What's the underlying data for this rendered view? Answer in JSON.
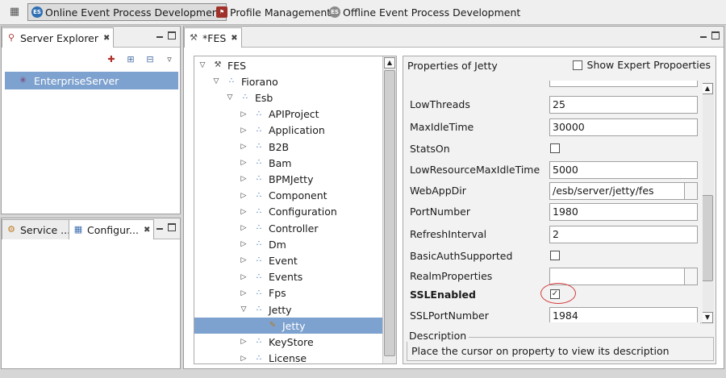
{
  "perspectives": {
    "items": [
      {
        "label": "Online Event Process Development",
        "icon": "es-circle-icon",
        "active": true
      },
      {
        "label": "Profile Management",
        "icon": "profile-icon",
        "active": false
      },
      {
        "label": "Offline Event Process Development",
        "icon": "es-circle-icon",
        "active": false
      }
    ]
  },
  "server_explorer": {
    "tab_label": "Server Explorer",
    "item": "EnterpriseServer"
  },
  "lower_left": {
    "tab1_label": "Service ...",
    "tab2_label": "Configur..."
  },
  "editor": {
    "tab_label": "*FES",
    "tree": [
      {
        "label": "FES",
        "depth": 0,
        "twisty": "open",
        "icon": "tools-icon"
      },
      {
        "label": "Fiorano",
        "depth": 1,
        "twisty": "open",
        "icon": "node-icon"
      },
      {
        "label": "Esb",
        "depth": 2,
        "twisty": "open",
        "icon": "node-icon"
      },
      {
        "label": "APIProject",
        "depth": 3,
        "twisty": "closed",
        "icon": "node-icon"
      },
      {
        "label": "Application",
        "depth": 3,
        "twisty": "closed",
        "icon": "node-icon"
      },
      {
        "label": "B2B",
        "depth": 3,
        "twisty": "closed",
        "icon": "node-icon"
      },
      {
        "label": "Bam",
        "depth": 3,
        "twisty": "closed",
        "icon": "node-icon"
      },
      {
        "label": "BPMJetty",
        "depth": 3,
        "twisty": "closed",
        "icon": "node-icon"
      },
      {
        "label": "Component",
        "depth": 3,
        "twisty": "closed",
        "icon": "node-icon"
      },
      {
        "label": "Configuration",
        "depth": 3,
        "twisty": "closed",
        "icon": "node-icon"
      },
      {
        "label": "Controller",
        "depth": 3,
        "twisty": "closed",
        "icon": "node-icon"
      },
      {
        "label": "Dm",
        "depth": 3,
        "twisty": "closed",
        "icon": "node-icon"
      },
      {
        "label": "Event",
        "depth": 3,
        "twisty": "closed",
        "icon": "node-icon"
      },
      {
        "label": "Events",
        "depth": 3,
        "twisty": "closed",
        "icon": "node-icon"
      },
      {
        "label": "Fps",
        "depth": 3,
        "twisty": "closed",
        "icon": "node-icon"
      },
      {
        "label": "Jetty",
        "depth": 3,
        "twisty": "open",
        "icon": "node-icon"
      },
      {
        "label": "Jetty",
        "depth": 4,
        "twisty": "none",
        "icon": "leaf-icon",
        "selected": true
      },
      {
        "label": "KeyStore",
        "depth": 3,
        "twisty": "closed",
        "icon": "node-icon"
      },
      {
        "label": "License",
        "depth": 3,
        "twisty": "closed",
        "icon": "node-icon"
      }
    ]
  },
  "properties": {
    "title": "Properties of Jetty",
    "expert_label": "Show Expert Propoerties",
    "expert_checked": false,
    "rows": [
      {
        "name": "",
        "kind": "text",
        "value": ""
      },
      {
        "name": "LowThreads",
        "kind": "text",
        "value": "25"
      },
      {
        "name": "MaxIdleTime",
        "kind": "text",
        "value": "30000"
      },
      {
        "name": "StatsOn",
        "kind": "checkbox",
        "checked": false
      },
      {
        "name": "LowResourceMaxIdleTime",
        "kind": "text",
        "value": "5000"
      },
      {
        "name": "WebAppDir",
        "kind": "file",
        "value": "/esb/server/jetty/fes"
      },
      {
        "name": "PortNumber",
        "kind": "text",
        "value": "1980"
      },
      {
        "name": "RefreshInterval",
        "kind": "text",
        "value": "2"
      },
      {
        "name": "BasicAuthSupported",
        "kind": "checkbox",
        "checked": false
      },
      {
        "name": "RealmProperties",
        "kind": "file",
        "value": ""
      },
      {
        "name": "SSLEnabled",
        "kind": "checkbox",
        "checked": true,
        "bold": true,
        "highlighted": true
      },
      {
        "name": "SSLPortNumber",
        "kind": "text",
        "value": "1984"
      }
    ],
    "description_title": "Description",
    "description_text": "Place the cursor on property to view its description"
  },
  "colors": {
    "selection": "#7ea2cf",
    "highlight_ring": "#d43a3a"
  }
}
